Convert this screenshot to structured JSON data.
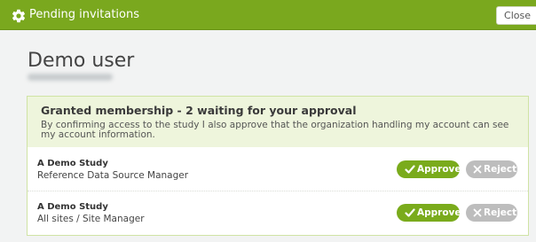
{
  "dialog": {
    "title": "Pending invitations",
    "close_label": "Close"
  },
  "user": {
    "name": "Demo user"
  },
  "membership": {
    "title": "Granted membership - 2 waiting for your approval",
    "description": "By confirming access to the study I also approve that the organization handling my account can see my account information.",
    "items": [
      {
        "study": "A Demo Study",
        "role": "Reference Data Source Manager",
        "approve_label": "Approve",
        "reject_label": "Reject"
      },
      {
        "study": "A Demo Study",
        "role": "All sites / Site Manager",
        "approve_label": "Approve",
        "reject_label": "Reject"
      }
    ]
  },
  "colors": {
    "header": "#7aa81e",
    "approve": "#7aab1c",
    "reject": "#bdbdbd",
    "panel_head": "#eef5dc"
  },
  "icons": {
    "header": "gear-icon",
    "approve": "check-icon",
    "reject": "x-icon"
  }
}
